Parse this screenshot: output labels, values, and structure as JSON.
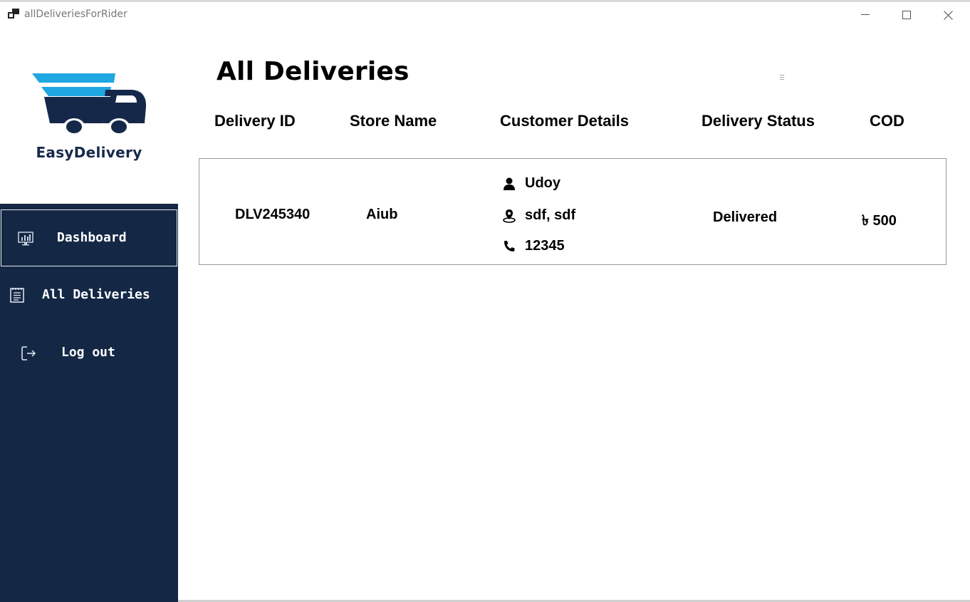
{
  "window": {
    "title": "allDeliveriesForRider"
  },
  "brand": {
    "name": "EasyDelivery",
    "colors": {
      "accent": "#1ea7e1",
      "navy": "#142846"
    }
  },
  "sidebar": {
    "items": [
      {
        "label": "Dashboard",
        "icon": "monitor-chart-icon",
        "active": true
      },
      {
        "label": "All Deliveries",
        "icon": "clipboard-list-icon",
        "active": false
      },
      {
        "label": "Log out",
        "icon": "logout-icon",
        "active": false
      }
    ]
  },
  "main": {
    "title": "All Deliveries",
    "columns": [
      "Delivery ID",
      "Store Name",
      "Customer Details",
      "Delivery Status",
      "COD"
    ],
    "rows": [
      {
        "delivery_id": "DLV245340",
        "store_name": "Aiub",
        "customer": {
          "name": "Udoy",
          "address": "sdf, sdf",
          "phone": "12345"
        },
        "status": "Delivered",
        "cod": "৳ 500"
      }
    ]
  }
}
